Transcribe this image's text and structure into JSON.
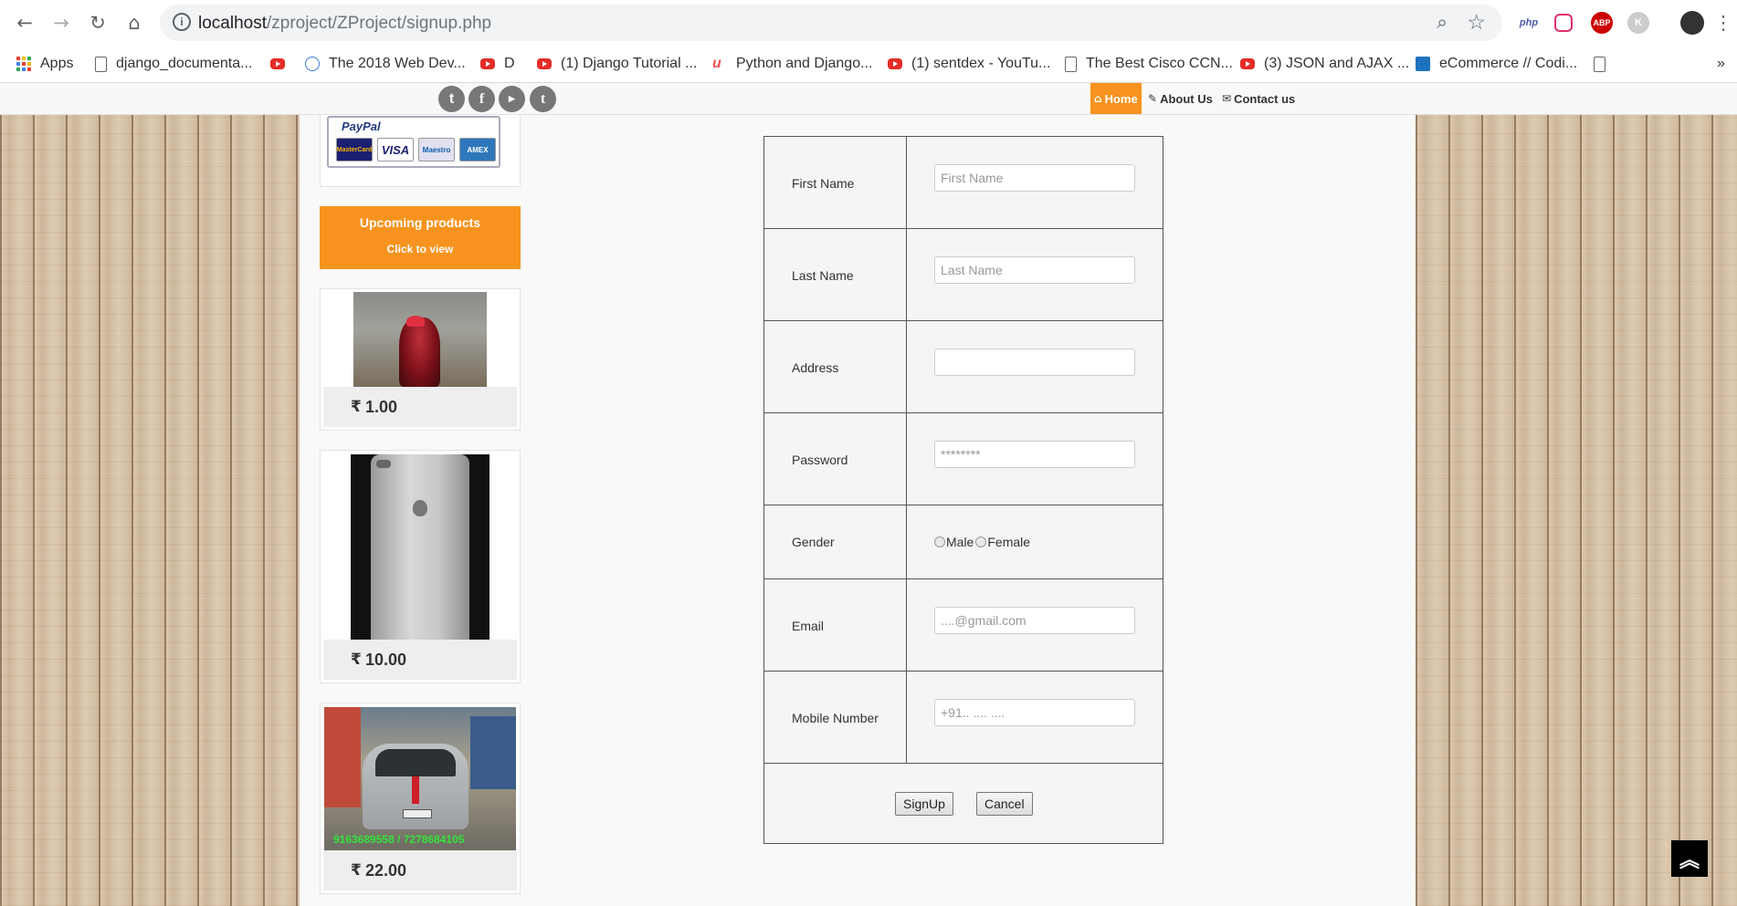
{
  "browser": {
    "url_host": "localhost",
    "url_path": "/zproject/ZProject/signup.php",
    "bookmarks": [
      {
        "label": "Apps",
        "icon": "apps-grid-icon"
      },
      {
        "label": "django_documenta...",
        "icon": "document-icon"
      },
      {
        "label": "",
        "icon": "youtube-icon"
      },
      {
        "label": "The 2018 Web Dev...",
        "icon": "site-favicon-icon"
      },
      {
        "label": "D",
        "icon": "youtube-icon"
      },
      {
        "label": "(1) Django Tutorial ...",
        "icon": "youtube-icon"
      },
      {
        "label": "Python and Django...",
        "icon": "udemy-icon"
      },
      {
        "label": "(1) sentdex - YouTu...",
        "icon": "youtube-icon"
      },
      {
        "label": "The Best Cisco CCN...",
        "icon": "document-icon"
      },
      {
        "label": "(3) JSON and AJAX ...",
        "icon": "youtube-icon"
      },
      {
        "label": "eCommerce // Codi...",
        "icon": "site-favicon-icon"
      }
    ],
    "extensions": [
      "php",
      "ABP",
      "K"
    ]
  },
  "navbar": {
    "home": "Home",
    "about": "About Us",
    "contact": "Contact us"
  },
  "sidebar": {
    "paypal_label": "PayPal",
    "card_labels": [
      "MasterCard",
      "VISA",
      "Maestro",
      "AMEX"
    ],
    "upcoming_title": "Upcoming products",
    "upcoming_cta": "Click to view",
    "products": [
      {
        "price": "1.00",
        "image": "rooster"
      },
      {
        "price": "10.00",
        "image": "iphone-back"
      },
      {
        "price": "22.00",
        "image": "silver-car",
        "overlay": "9163689558 / 7278684105"
      }
    ],
    "currency_symbol": "₹"
  },
  "form": {
    "first_name": {
      "label": "First Name",
      "placeholder": "First Name"
    },
    "last_name": {
      "label": "Last Name",
      "placeholder": "Last Name"
    },
    "address": {
      "label": "Address",
      "placeholder": ""
    },
    "password": {
      "label": "Password",
      "placeholder": "********"
    },
    "gender": {
      "label": "Gender",
      "options": [
        "Male",
        "Female"
      ]
    },
    "email": {
      "label": "Email",
      "placeholder": "....@gmail.com"
    },
    "mobile": {
      "label": "Mobile Number",
      "placeholder": "+91.. .... ...."
    },
    "signup_label": "SignUp",
    "cancel_label": "Cancel"
  },
  "colors": {
    "accent": "#f7931e"
  }
}
